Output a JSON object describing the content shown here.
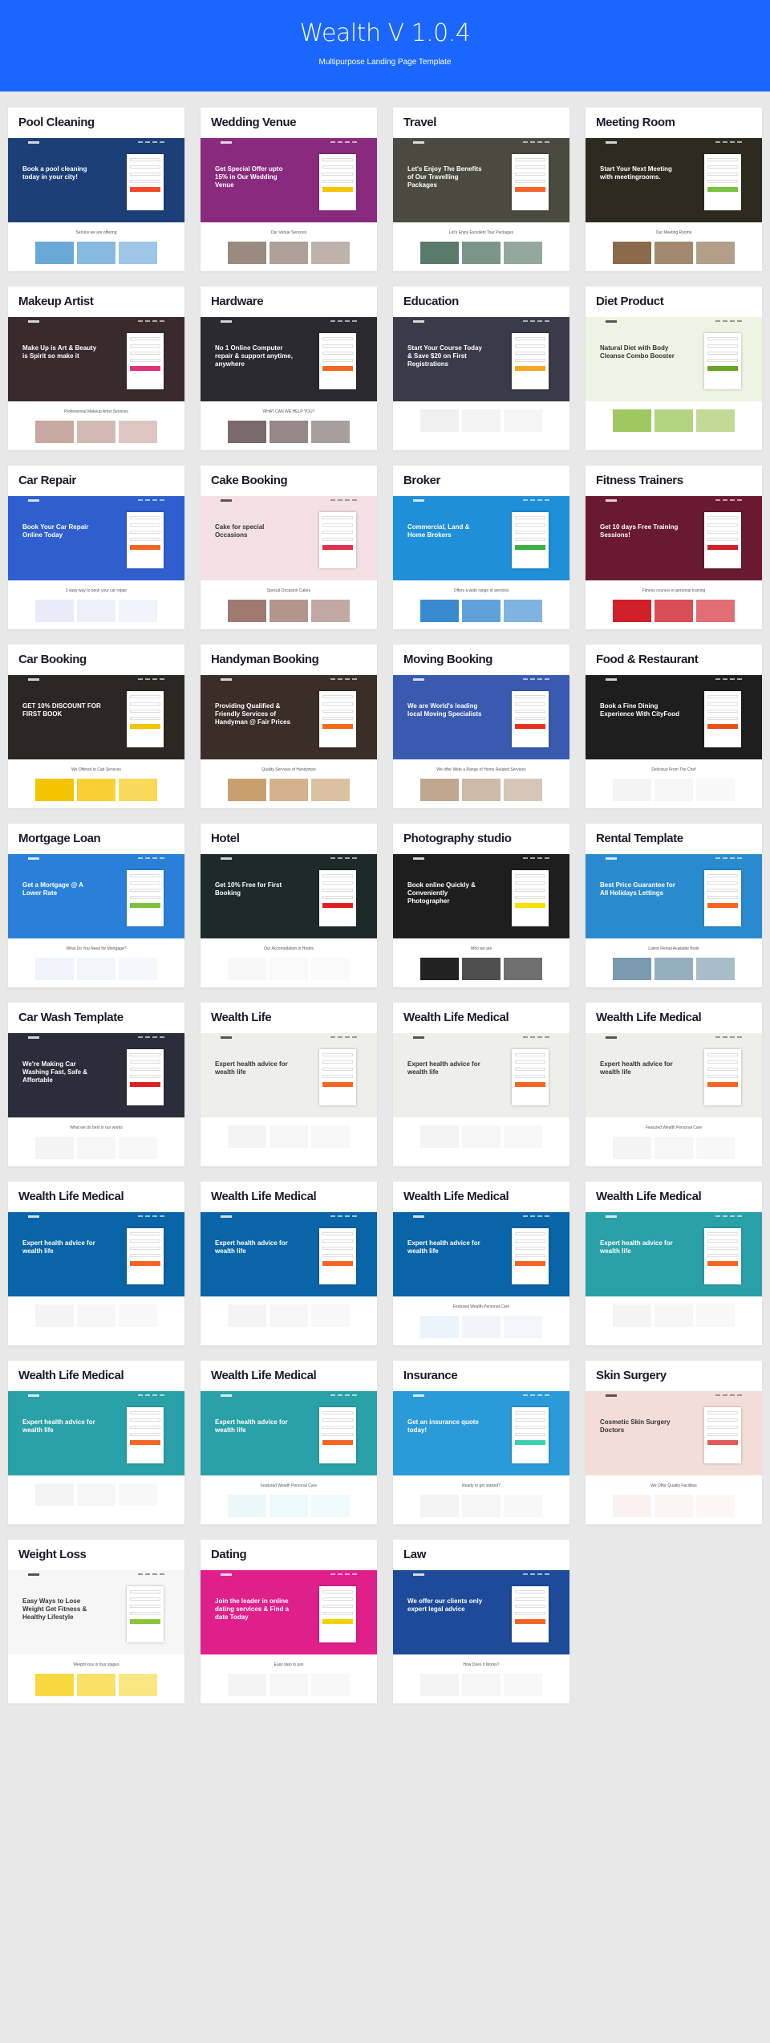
{
  "header": {
    "title": "Wealth V 1.0.4",
    "subtitle": "Multipurpose Landing Page Template",
    "background": "#1a66ff"
  },
  "templates": [
    {
      "title": "Pool Cleaning",
      "hero": "#1d3f78",
      "accent": "#f04a2a",
      "headline": "Book a pool cleaning today in your city!",
      "caption": "Service we are offering",
      "pic": "#6aa8d8"
    },
    {
      "title": "Wedding Venue",
      "hero": "#8a2a7e",
      "accent": "#f5c400",
      "headline": "Get Special Offer upto 15% in Our Wedding Venue",
      "caption": "Our Venue Services",
      "pic": "#9a8a80"
    },
    {
      "title": "Travel",
      "hero": "#4a4a40",
      "accent": "#f4642a",
      "headline": "Let's Enjoy The Benefits of Our Travelling Packages",
      "caption": "Let's Enjoy Excellent Tour Packages",
      "pic": "#5a7a6a"
    },
    {
      "title": "Meeting Room",
      "hero": "#2e2a20",
      "accent": "#7ac142",
      "headline": "Start Your Next Meeting with meetingrooms.",
      "caption": "Our Meeting Rooms",
      "pic": "#8a6a4a"
    },
    {
      "title": "Makeup Artist",
      "hero": "#3a2a2e",
      "accent": "#e0307a",
      "headline": "Make Up is Art & Beauty is Spirit so make it",
      "caption": "Professional Makeup Artist Services",
      "pic": "#c8a8a0"
    },
    {
      "title": "Hardware",
      "hero": "#2a2a30",
      "accent": "#f26522",
      "headline": "No 1 Online Computer repair & support anytime, anywhere",
      "caption": "WHAT CAN WE HELP YOU?",
      "pic": "#7a6a6a"
    },
    {
      "title": "Education",
      "hero": "#3a3a48",
      "accent": "#f5a623",
      "headline": "Start Your Course Today & Save $20 on First Registrations",
      "caption": "",
      "pic": "#f0f0f0"
    },
    {
      "title": "Diet Product",
      "hero": "#eef4e4",
      "accent": "#6aa324",
      "headline": "Natural Diet with Body Cleanse Combo Booster",
      "caption": "",
      "pic": "#a0c860"
    },
    {
      "title": "Car Repair",
      "hero": "#2f5fcf",
      "accent": "#f26522",
      "headline": "Book Your Car Repair Online Today",
      "caption": "3 easy way to book your car repair",
      "pic": "#e8ecf8"
    },
    {
      "title": "Cake Booking",
      "hero": "#f4e0e4",
      "accent": "#e03050",
      "headline": "Cake for special Occasions",
      "caption": "Special Occasion Cakes",
      "pic": "#a07a70"
    },
    {
      "title": "Broker",
      "hero": "#1f8fd8",
      "accent": "#3cb043",
      "headline": "Commercial, Land & Home Brokers",
      "caption": "Offers a wide range of services",
      "pic": "#3a8ad0"
    },
    {
      "title": "Fitness Trainers",
      "hero": "#6a1a30",
      "accent": "#d0202a",
      "headline": "Get 10 days Free Training Sessions!",
      "caption": "Fitness courses in personal training",
      "pic": "#d0202a"
    },
    {
      "title": "Car Booking",
      "hero": "#2a2820",
      "accent": "#f5c400",
      "headline": "GET 10% DISCOUNT FOR FIRST BOOK",
      "caption": "We Offered to Cab Services",
      "pic": "#f5c400"
    },
    {
      "title": "Handyman Booking",
      "hero": "#3a2e28",
      "accent": "#f26a1a",
      "headline": "Providing Qualified & Friendly Services of Handyman @ Fair Prices",
      "caption": "Quality Services of Handyman",
      "pic": "#c8a070"
    },
    {
      "title": "Moving Booking",
      "hero": "#3a5ab0",
      "accent": "#e8301a",
      "headline": "We are World's leading local Moving Specialists",
      "caption": "We offer Wide a Range of Home Related Services",
      "pic": "#c0a890"
    },
    {
      "title": "Food & Restaurant",
      "hero": "#1e1e1e",
      "accent": "#e8501a",
      "headline": "Book a Fine Dining Experience With CityFood",
      "caption": "Delicious From The Chef",
      "pic": "#f4f4f4"
    },
    {
      "title": "Mortgage Loan",
      "hero": "#2a80d8",
      "accent": "#7ac142",
      "headline": "Get a Mortgage @ A Lower Rate",
      "caption": "What Do You Need for Mortgage?",
      "pic": "#eef4fa"
    },
    {
      "title": "Hotel",
      "hero": "#1e2a2a",
      "accent": "#e02020",
      "headline": "Get 10% Free for First Booking",
      "caption": "Our Accomodation in Hotels",
      "pic": "#f8f8f8"
    },
    {
      "title": "Photography studio",
      "hero": "#1e1e1e",
      "accent": "#f5e000",
      "headline": "Book online Quickly & Conveniently Photographer",
      "caption": "Who we are",
      "pic": "#222222"
    },
    {
      "title": "Rental Template",
      "hero": "#2a8ad0",
      "accent": "#f26522",
      "headline": "Best Price Guarantee for All Holidays Lettings",
      "caption": "Latest Rental Available Book",
      "pic": "#7a9ab0"
    },
    {
      "title": "Car Wash Template",
      "hero": "#2a2e3a",
      "accent": "#e02020",
      "headline": "We're Making Car Washing Fast, Safe & Affortable",
      "caption": "What we do best in our works",
      "pic": "#f4f4f4"
    },
    {
      "title": "Wealth Life",
      "hero": "#eeeeea",
      "accent": "#f26522",
      "headline": "Expert health advice for wealth life",
      "caption": "",
      "pic": "#f4f4f4"
    },
    {
      "title": "Wealth Life Medical",
      "hero": "#eeeeea",
      "accent": "#f26522",
      "headline": "Expert health advice for wealth life",
      "caption": "",
      "pic": "#f4f4f4"
    },
    {
      "title": "Wealth Life Medical",
      "hero": "#eeeeea",
      "accent": "#f26522",
      "headline": "Expert health advice for wealth life",
      "caption": "Featured Wealth Personal Care",
      "pic": "#f4f4f4"
    },
    {
      "title": "Wealth Life Medical",
      "hero": "#0a64a8",
      "accent": "#f26522",
      "headline": "Expert health advice for wealth life",
      "caption": "",
      "pic": "#f4f4f4"
    },
    {
      "title": "Wealth Life Medical",
      "hero": "#0a64a8",
      "accent": "#f26522",
      "headline": "Expert health advice for wealth life",
      "caption": "",
      "pic": "#f4f4f4"
    },
    {
      "title": "Wealth Life Medical",
      "hero": "#0a64a8",
      "accent": "#f26522",
      "headline": "Expert health advice for wealth life",
      "caption": "Featured Wealth Personal Care",
      "pic": "#eaf4fa"
    },
    {
      "title": "Wealth Life Medical",
      "hero": "#2aa0a8",
      "accent": "#f26522",
      "headline": "Expert health advice for wealth life",
      "caption": "",
      "pic": "#f4f4f4"
    },
    {
      "title": "Wealth Life Medical",
      "hero": "#2aa0a8",
      "accent": "#f26522",
      "headline": "Expert health advice for wealth life",
      "caption": "",
      "pic": "#f4f4f4"
    },
    {
      "title": "Wealth Life Medical",
      "hero": "#2aa0a8",
      "accent": "#f26522",
      "headline": "Expert health advice for wealth life",
      "caption": "Featured Wealth Personal Care",
      "pic": "#eaf8fa"
    },
    {
      "title": "Insurance",
      "hero": "#2a9ad8",
      "accent": "#3ad0b0",
      "headline": "Get an insurance quote today!",
      "caption": "Ready to get started?",
      "pic": "#f4f4f4"
    },
    {
      "title": "Skin Surgery",
      "hero": "#f4dcd8",
      "accent": "#e05a5a",
      "headline": "Cosmetic Skin Surgery Doctors",
      "caption": "We Offer Quality Facilities",
      "pic": "#fbf2f0"
    },
    {
      "title": "Weight Loss",
      "hero": "#f6f6f6",
      "accent": "#8ac43a",
      "headline": "Easy Ways to Lose Weight Get Fitness & Healthy Lifestyle",
      "caption": "Weight loss in four stages",
      "pic": "#f8d840"
    },
    {
      "title": "Dating",
      "hero": "#e0208a",
      "accent": "#f5d000",
      "headline": "Join the leader in online dating services & Find a date Today",
      "caption": "Easy step to join",
      "pic": "#f4f4f4"
    },
    {
      "title": "Law",
      "hero": "#1e4a9a",
      "accent": "#f26522",
      "headline": "We offer our clients only expert legal advice",
      "caption": "How Does it Works?",
      "pic": "#f4f4f4"
    }
  ]
}
